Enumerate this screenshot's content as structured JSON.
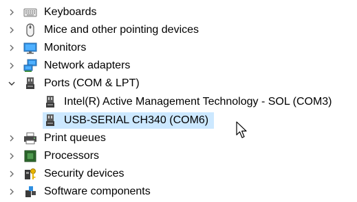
{
  "device_tree": {
    "keyboards": "Keyboards",
    "mice": "Mice and other pointing devices",
    "monitors": "Monitors",
    "network": "Network adapters",
    "ports": "Ports (COM & LPT)",
    "ports_children": {
      "intel_amt": "Intel(R) Active Management Technology - SOL (COM3)",
      "usb_serial": "USB-SERIAL CH340 (COM6)"
    },
    "print_queues": "Print queues",
    "processors": "Processors",
    "security": "Security devices",
    "software": "Software components"
  },
  "colors": {
    "selection": "#cce8ff",
    "chevron": "#6b6b6b"
  },
  "icons": {
    "keyboards": "keyboard-icon",
    "mice": "mouse-icon",
    "monitors": "monitor-icon",
    "network": "network-adapter-icon",
    "ports": "port-connector-icon",
    "print_queues": "printer-icon",
    "processors": "processor-chip-icon",
    "security": "security-key-icon",
    "software": "software-components-icon"
  }
}
